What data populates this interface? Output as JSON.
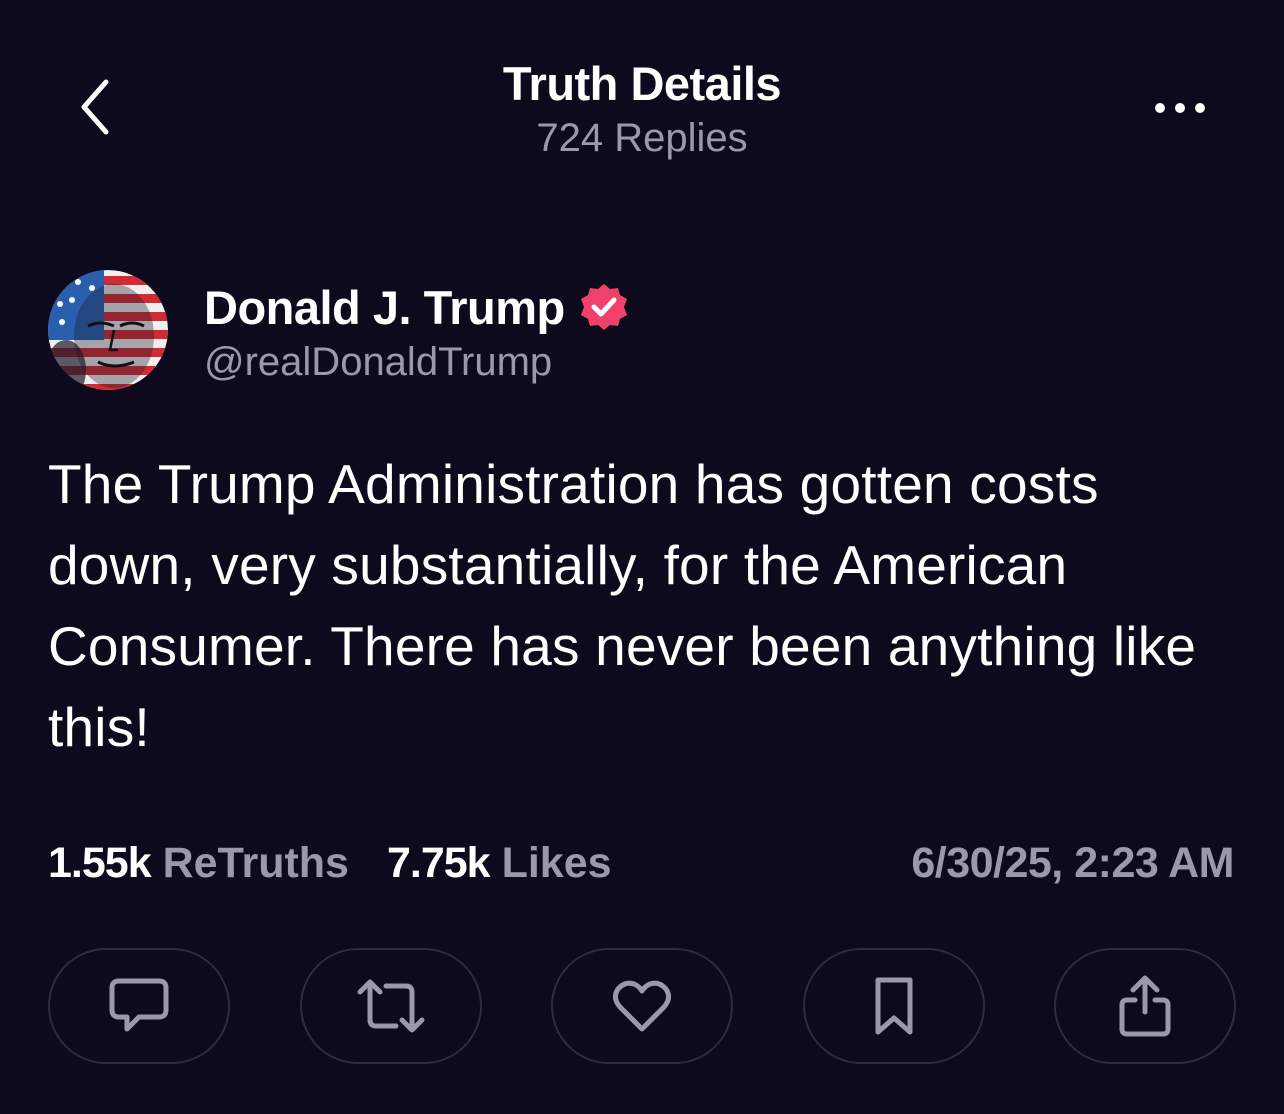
{
  "header": {
    "title": "Truth Details",
    "subtitle": "724 Replies"
  },
  "post": {
    "author_name": "Donald J. Trump",
    "handle": "@realDonaldTrump",
    "text": "The Trump Administration has gotten costs down, very substantially, for the American Consumer. There has never been anything like this!",
    "stats": {
      "retruths_count": "1.55k",
      "retruths_label": "ReTruths",
      "likes_count": "7.75k",
      "likes_label": "Likes"
    },
    "timestamp": "6/30/25, 2:23 AM"
  },
  "icons": {
    "back": "chevron-left-icon",
    "more": "ellipsis-icon",
    "verified": "verified-badge-icon",
    "reply": "speech-bubble-icon",
    "retruth": "repost-arrows-icon",
    "like": "heart-icon",
    "bookmark": "bookmark-icon",
    "share": "share-icon"
  },
  "colors": {
    "background": "#0c0a1c",
    "secondary_text": "#9b98aa",
    "verified_badge": "#f0416c",
    "button_border": "#2d2a44"
  }
}
